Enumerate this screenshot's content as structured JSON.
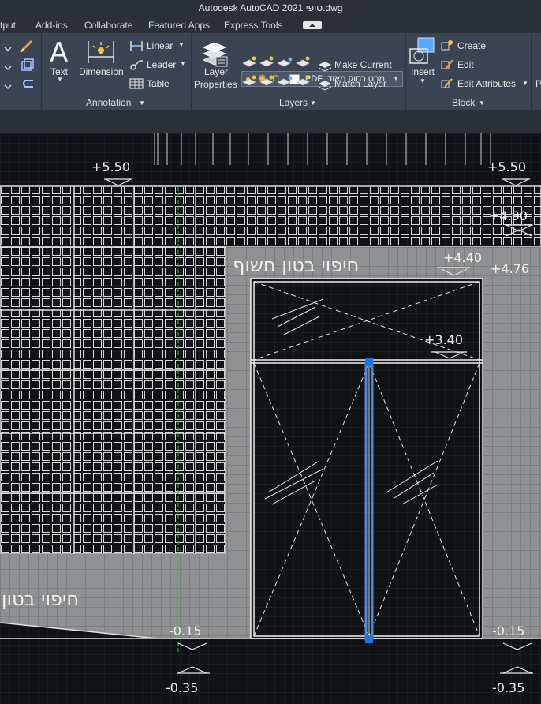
{
  "app": {
    "title": "Autodesk AutoCAD 2021   סופי.dwg"
  },
  "tabs": [
    "tput",
    "Add-ins",
    "Collaborate",
    "Featured Apps",
    "Express Tools"
  ],
  "ribbon": {
    "annotation": {
      "title": "Annotation",
      "text": "Text",
      "dimension": "Dimension",
      "linear": "Linear",
      "leader": "Leader",
      "table": "Table"
    },
    "layers": {
      "title": "Layers",
      "layer_properties_1": "Layer",
      "layer_properties_2": "Properties",
      "current_layer": "PDF_מבט רחוק מאוד",
      "make_current": "Make Current",
      "match_layer": "Match Layer"
    },
    "block": {
      "title": "Block",
      "insert": "Insert",
      "create": "Create",
      "edit": "Edit",
      "edit_attributes": "Edit Attributes"
    }
  },
  "drawing": {
    "elevations": {
      "top_left": "+5.50",
      "top_right": "+5.50",
      "right_490": "+4.90",
      "door_top": "+4.40",
      "right_476": "+4.76",
      "transom": "+3.40",
      "floor_left": "-0.15",
      "floor_right": "-0.15",
      "base_left": "-0.35",
      "base_right": "-0.35"
    },
    "labels": {
      "concrete_top": "חיפוי בטון חשוף",
      "concrete_bottom": "חיפוי בטון"
    }
  },
  "colors": {
    "ribbon": "#3b4452",
    "canvas": "#101215",
    "grip": "#1e73e8",
    "cladding": "#8e9092",
    "selection": "#4f88d6",
    "guide": "#39b54a"
  }
}
